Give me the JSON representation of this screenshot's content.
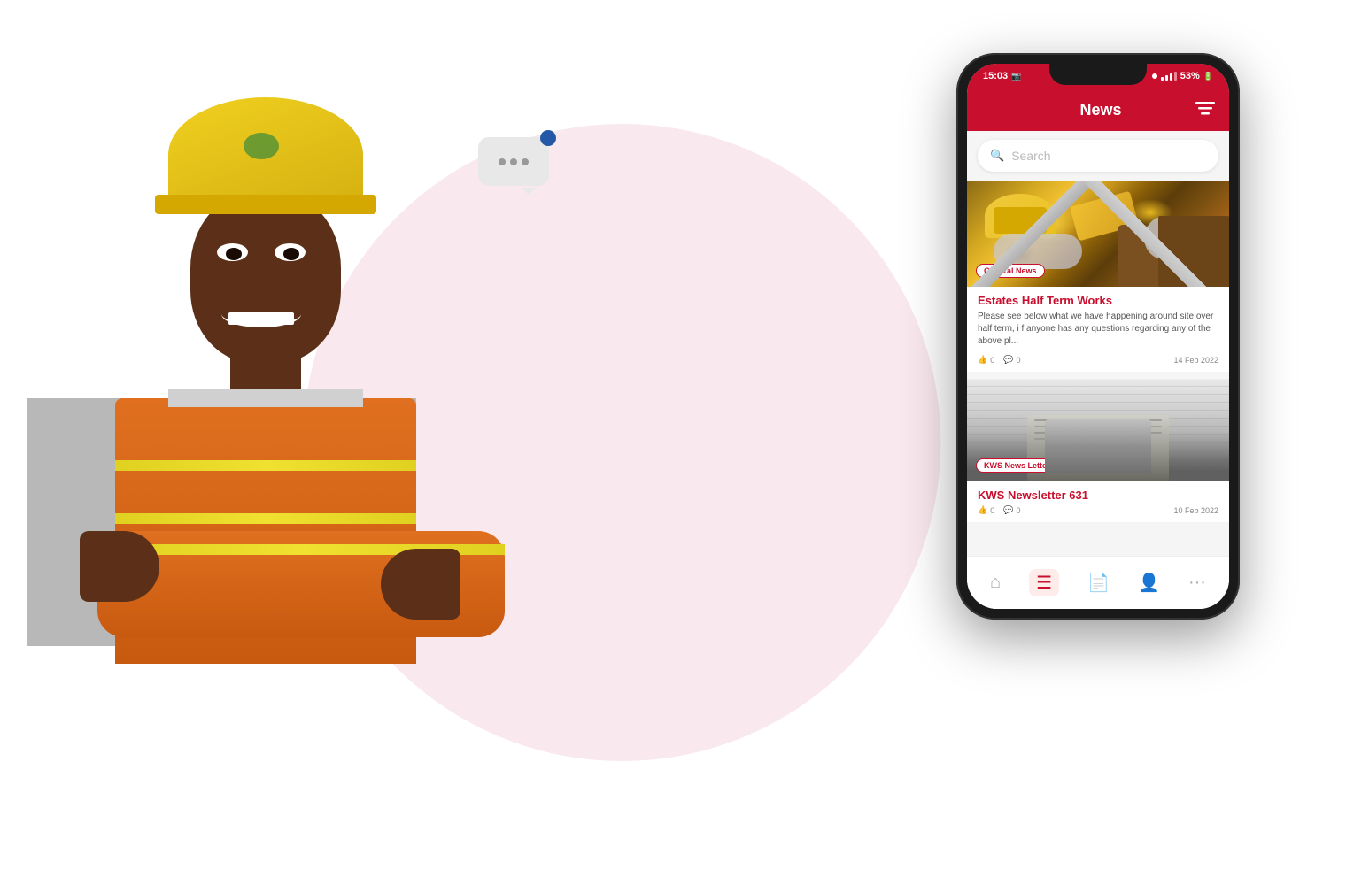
{
  "background": {
    "circle_color": "#f9e8ee"
  },
  "chat_bubble": {
    "dots": [
      "•",
      "•",
      "•"
    ]
  },
  "phone": {
    "status_bar": {
      "time": "15:03",
      "battery": "53%",
      "signal": "lll"
    },
    "header": {
      "title": "News",
      "filter_icon": "≡"
    },
    "search": {
      "placeholder": "Search"
    },
    "news_cards": [
      {
        "id": 1,
        "category": "General News",
        "image_type": "construction_tools",
        "title": "Estates Half Term Works",
        "excerpt": "Please see below what we have happening around site over half term, i f anyone has any questions regarding any of the above pl...",
        "likes": "0",
        "comments": "0",
        "date": "14 Feb 2022"
      },
      {
        "id": 2,
        "category": "KWS News Letter",
        "image_type": "newspaper",
        "title": "KWS Newsletter 631",
        "excerpt": "",
        "likes": "0",
        "comments": "0",
        "date": "10 Feb 2022"
      }
    ],
    "bottom_nav": {
      "items": [
        {
          "icon": "⌂",
          "label": "Home",
          "active": false
        },
        {
          "icon": "☰",
          "label": "News",
          "active": true
        },
        {
          "icon": "📄",
          "label": "Documents",
          "active": false
        },
        {
          "icon": "👤",
          "label": "Profile",
          "active": false
        },
        {
          "icon": "···",
          "label": "More",
          "active": false
        }
      ]
    },
    "android_nav": {
      "back": "|||",
      "home": "○",
      "recent": "<"
    }
  }
}
